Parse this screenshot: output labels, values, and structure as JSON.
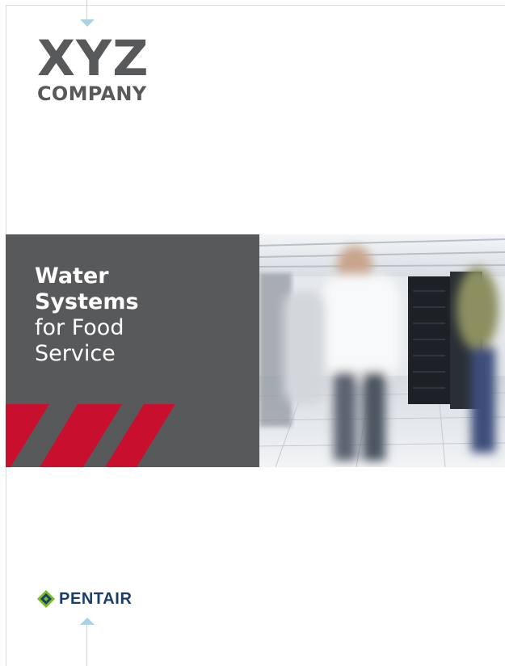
{
  "company_logo": {
    "line1": "XYZ",
    "line2": "COMPANY"
  },
  "cover": {
    "title_bold_line1": "Water",
    "title_bold_line2": "Systems",
    "title_light_line1": "for Food",
    "title_light_line2": "Service"
  },
  "brand": {
    "name": "PENTAIR"
  },
  "colors": {
    "band_gray": "#58595b",
    "stripe_red": "#c8102e",
    "pentair_navy": "#1c3c6c",
    "pentair_green": "#78be20",
    "guide_blue": "#a9d3e3"
  },
  "icons": {
    "pentair_mark": "pentair-diamond-icon",
    "crop_marks": "triangle-guide-icon"
  },
  "photo": {
    "subject": "data-center-corridor-photo"
  }
}
